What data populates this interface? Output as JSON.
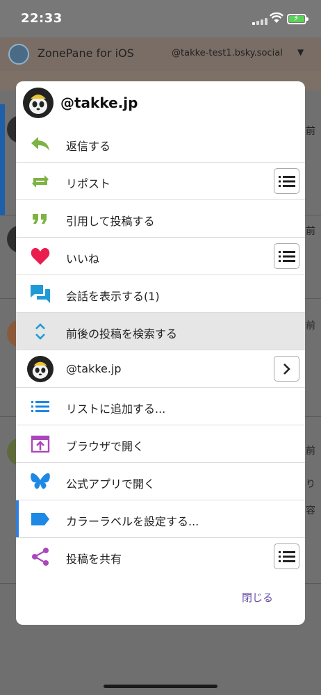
{
  "status_bar": {
    "time": "22:33"
  },
  "app_header": {
    "app_title": "ZonePane for iOS",
    "account": "@takke-test1.bsky.social"
  },
  "background_timeline": {
    "side_texts": [
      "前",
      "前",
      "前",
      "前",
      "り",
      "容"
    ]
  },
  "dialog": {
    "user_handle": "@takke.jp",
    "menu_items": [
      {
        "label": "返信する",
        "icon": "reply-icon",
        "icon_color": "#7cb342"
      },
      {
        "label": "リポスト",
        "icon": "repost-icon",
        "icon_color": "#7cb342",
        "trailing": "list-button"
      },
      {
        "label": "引用して投稿する",
        "icon": "quote-icon",
        "icon_color": "#7cb342"
      },
      {
        "label": "いいね",
        "icon": "heart-icon",
        "icon_color": "#e91e4f",
        "trailing": "list-button"
      },
      {
        "label": "会話を表示する(1)",
        "icon": "conversation-icon",
        "icon_color": "#1e9bd7"
      },
      {
        "label": "前後の投稿を検索する",
        "icon": "expand-vertical-icon",
        "icon_color": "#1e9bd7",
        "selected": true
      },
      {
        "label": "@takke.jp",
        "icon": "avatar",
        "trailing": "chevron-button"
      },
      {
        "label": "リストに追加する...",
        "icon": "list-icon",
        "icon_color": "#1e88e5"
      },
      {
        "label": "ブラウザで開く",
        "icon": "open-in-browser-icon",
        "icon_color": "#ab47bc"
      },
      {
        "label": "公式アプリで開く",
        "icon": "butterfly-icon",
        "icon_color": "#1e88e5"
      },
      {
        "label": "カラーラベルを設定する...",
        "icon": "label-icon",
        "icon_color": "#1e88e5",
        "accent_left": true
      },
      {
        "label": "投稿を共有",
        "icon": "share-icon",
        "icon_color": "#ab47bc",
        "trailing": "list-button"
      }
    ],
    "close_label": "閉じる"
  },
  "colors": {
    "accent_blue": "#2f7ee0",
    "close_text": "#6a4ea8",
    "selected_bg": "#e6e6e6"
  }
}
